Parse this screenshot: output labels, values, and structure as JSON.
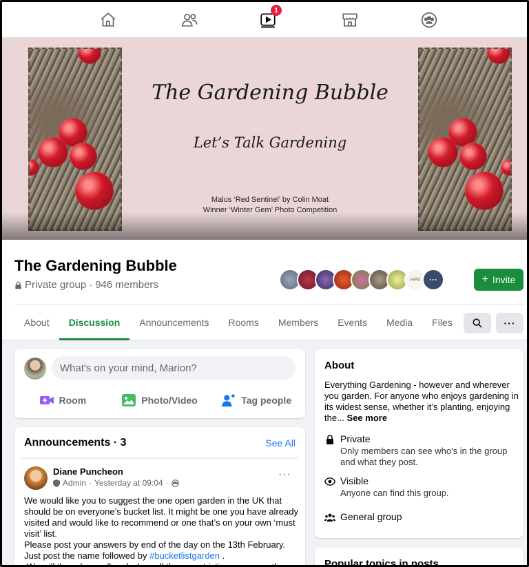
{
  "nav": {
    "items": [
      {
        "name": "home",
        "icon": "home-icon"
      },
      {
        "name": "groups",
        "icon": "people-icon"
      },
      {
        "name": "watch",
        "icon": "video-icon",
        "badge": "1"
      },
      {
        "name": "marketplace",
        "icon": "store-icon"
      },
      {
        "name": "group-feed",
        "icon": "group-icon"
      }
    ],
    "badge_color": "#e41e3f"
  },
  "cover": {
    "title": "The Gardening Bubble",
    "subtitle": "Let’s Talk Gardening",
    "credit_line1": "Malus ‘Red Sentinel’ by Colin Moat",
    "credit_line2": "Winner ‘Winter Gem’ Photo Competition"
  },
  "group": {
    "name": "The Gardening Bubble",
    "privacy": "Private group",
    "separator": "·",
    "members": "946 members",
    "invite_label": "Invite",
    "member_avatars_more": "···",
    "member_avatar_hps": "HPS"
  },
  "tabs": [
    {
      "label": "About",
      "active": false
    },
    {
      "label": "Discussion",
      "active": true
    },
    {
      "label": "Announcements",
      "active": false
    },
    {
      "label": "Rooms",
      "active": false
    },
    {
      "label": "Members",
      "active": false
    },
    {
      "label": "Events",
      "active": false
    },
    {
      "label": "Media",
      "active": false
    },
    {
      "label": "Files",
      "active": false
    }
  ],
  "toolbar": {
    "more_label": "···"
  },
  "composer": {
    "placeholder": "What's on your mind, Marion?",
    "actions": [
      {
        "label": "Room",
        "icon": "video-plus-icon"
      },
      {
        "label": "Photo/Video",
        "icon": "photo-icon"
      },
      {
        "label": "Tag people",
        "icon": "tag-people-icon"
      }
    ]
  },
  "announcements": {
    "title": "Announcements · 3",
    "see_all": "See All",
    "post": {
      "author": "Diane Puncheon",
      "role": "Admin",
      "time": "Yesterday at 09:04",
      "more": "···",
      "para1": "We would like you to suggest the one open garden in the UK that should be on everyone’s bucket list. It might be one you have already visited and would like to recommend or one that’s on your own ‘must visit’ list.",
      "para2": "Please post your answers by end of the day on the 13th February.",
      "para3_pre": "Just post the name followed by ",
      "para3_tag": "#bucketlistgarden",
      "para3_post": " .",
      "para4": " We will then do a poll and when all these restrictions are over there"
    }
  },
  "about": {
    "title": "About",
    "description": "Everything Gardening - however and wherever you garden. For anyone who enjoys gardening in its widest sense, whether it’s planting, enjoying the... ",
    "see_more": "See more",
    "rows": [
      {
        "title": "Private",
        "desc": "Only members can see who's in the group and what they post.",
        "icon": "lock-icon"
      },
      {
        "title": "Visible",
        "desc": "Anyone can find this group.",
        "icon": "eye-icon"
      },
      {
        "title": "General group",
        "desc": "",
        "icon": "group-icon"
      }
    ]
  },
  "topics": {
    "title": "Popular topics in posts"
  },
  "colors": {
    "accent": "#1a8d3c",
    "link": "#1877f2"
  }
}
